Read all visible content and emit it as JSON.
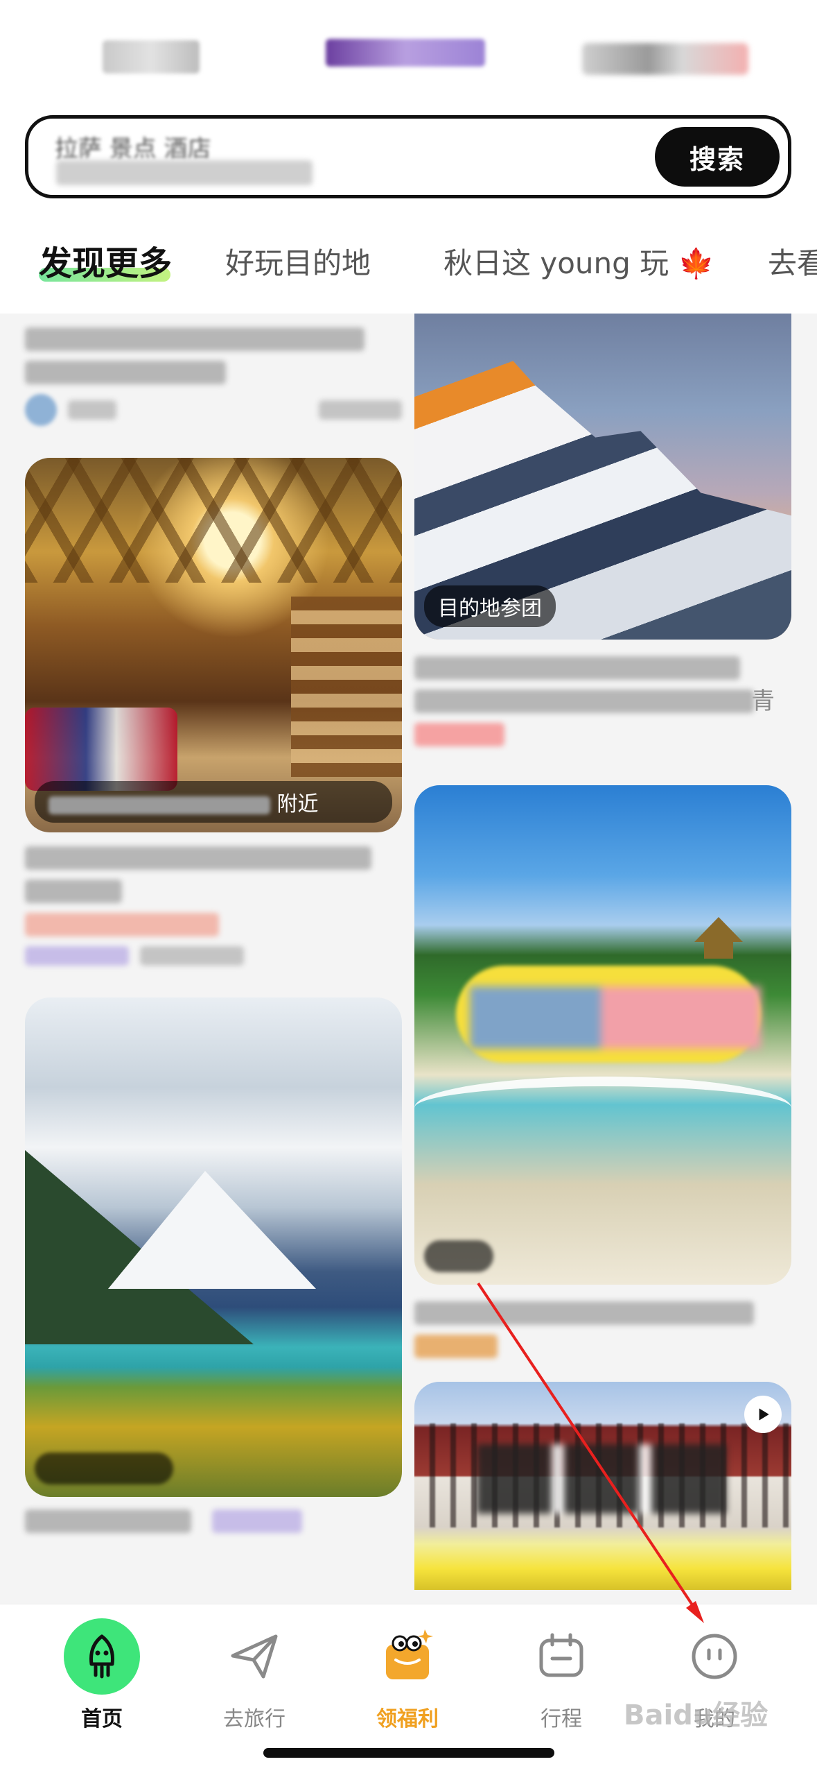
{
  "search": {
    "hint": "拉萨 景点 酒店",
    "button_label": "搜索"
  },
  "tabs": [
    {
      "label": "发现更多"
    },
    {
      "label": "好玩目的地"
    },
    {
      "label": "秋日这 young 玩"
    },
    {
      "label": "去看"
    }
  ],
  "tab_leaf": "🍁",
  "feed": {
    "left": {
      "cafe_card": {
        "label": "附近"
      },
      "lake_card": {
        "label": ""
      }
    },
    "right": {
      "everest_card": {
        "label": "目的地参团",
        "line2_tail": "青"
      },
      "sanya_card": {
        "label": ""
      },
      "lhasa_card": {
        "label": ""
      }
    }
  },
  "bottom_nav": [
    {
      "label": "首页",
      "icon": "rocket-icon"
    },
    {
      "label": "去旅行",
      "icon": "paper-plane-icon"
    },
    {
      "label": "领福利",
      "icon": "gift-mascot-icon"
    },
    {
      "label": "行程",
      "icon": "calendar-icon"
    },
    {
      "label": "我的",
      "icon": "face-icon"
    }
  ],
  "colors": {
    "accent_green": "#3ee57a",
    "welfare_orange": "#f0a020",
    "annotation_red": "#e8201e"
  },
  "watermark": "Baidu经验"
}
